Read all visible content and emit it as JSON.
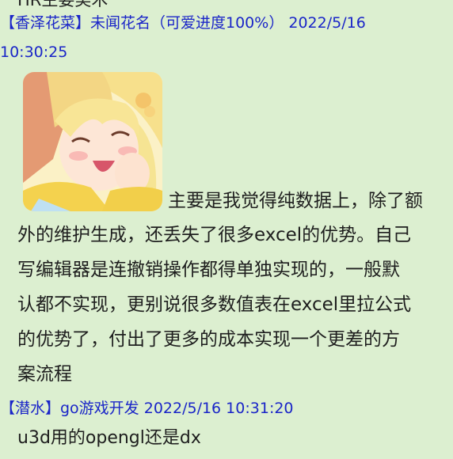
{
  "previous_message_tail": "HR主要美术",
  "messages": [
    {
      "header_line1": "【香泽花菜】未闻花名（可爱进度100%） 2022/5/16",
      "header_line2": "10:30:25",
      "sticker_icon": "anime-girl-sticker",
      "lines": [
        "主要是我觉得纯数据上，除了额",
        "外的维护生成，还丢失了很多excel的优势。自己",
        "写编辑器是连撤销操作都得单独实现的，一般默",
        "认都不实现，更别说很多数值表在excel里拉公式",
        "的优势了，付出了更多的成本实现一个更差的方",
        "案流程"
      ]
    },
    {
      "header_line1": "【潜水】go游戏开发 2022/5/16 10:31:20",
      "text": "u3d用的opengl还是dx"
    }
  ],
  "colors": {
    "background": "#dcefd0",
    "header": "#1a25c8",
    "text": "#1e1e1e"
  }
}
